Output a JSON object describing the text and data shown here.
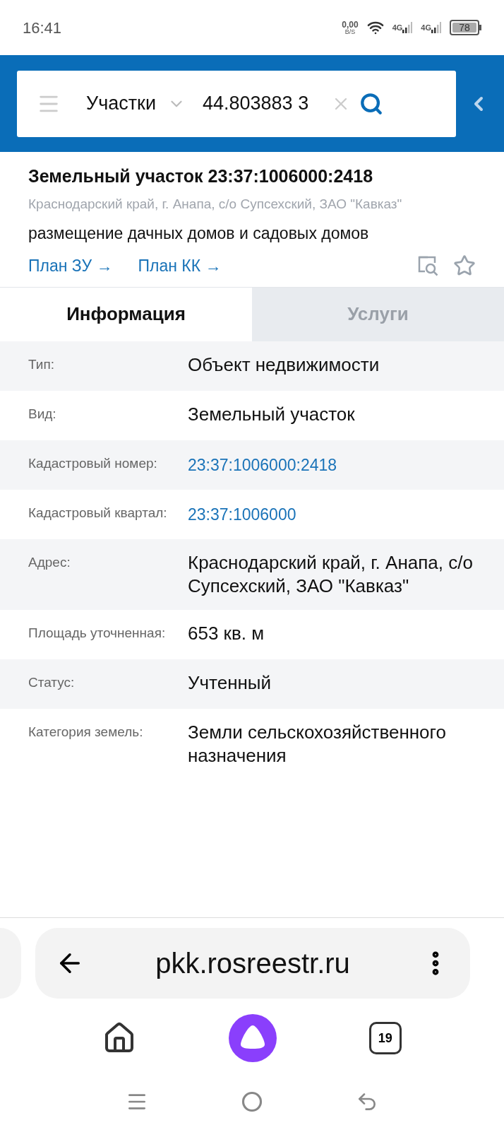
{
  "status_bar": {
    "time": "16:41",
    "net_speed": "0,00",
    "net_unit": "B/S",
    "sim1": "4G",
    "sim2": "4G",
    "battery": "78"
  },
  "search_bar": {
    "layer": "Участки",
    "query": "44.803883 3"
  },
  "object": {
    "title": "Земельный участок 23:37:1006000:2418",
    "address": "Краснодарский край, г. Анапа, с/о Супсехский, ЗАО \"Кавказ\"",
    "usage": "размещение дачных домов и садовых домов",
    "links": [
      "План ЗУ →",
      "План КК →"
    ]
  },
  "tabs": [
    {
      "label": "Информация",
      "selected": true
    },
    {
      "label": "Услуги",
      "selected": false
    }
  ],
  "rows": [
    {
      "label": "Тип:",
      "value": "Объект недвижимости",
      "kind": "text"
    },
    {
      "label": "Вид:",
      "value": "Земельный участок",
      "kind": "text"
    },
    {
      "label": "Кадастровый номер:",
      "value": "23:37:1006000:2418",
      "kind": "link"
    },
    {
      "label": "Кадастровый квартал:",
      "value": "23:37:1006000",
      "kind": "link"
    },
    {
      "label": "Адрес:",
      "value": "Краснодарский край, г. Анапа, с/о Супсехский, ЗАО \"Кавказ\"",
      "kind": "text"
    },
    {
      "label": "Площадь уточненная:",
      "value": "653 кв. м",
      "kind": "text"
    },
    {
      "label": "Статус:",
      "value": "Учтенный",
      "kind": "text"
    },
    {
      "label": "Категория земель:",
      "value": "Земли сельскохозяйственного назначения",
      "kind": "text"
    }
  ],
  "browser": {
    "url": "pkk.rosreestr.ru",
    "tab_count": "19"
  }
}
